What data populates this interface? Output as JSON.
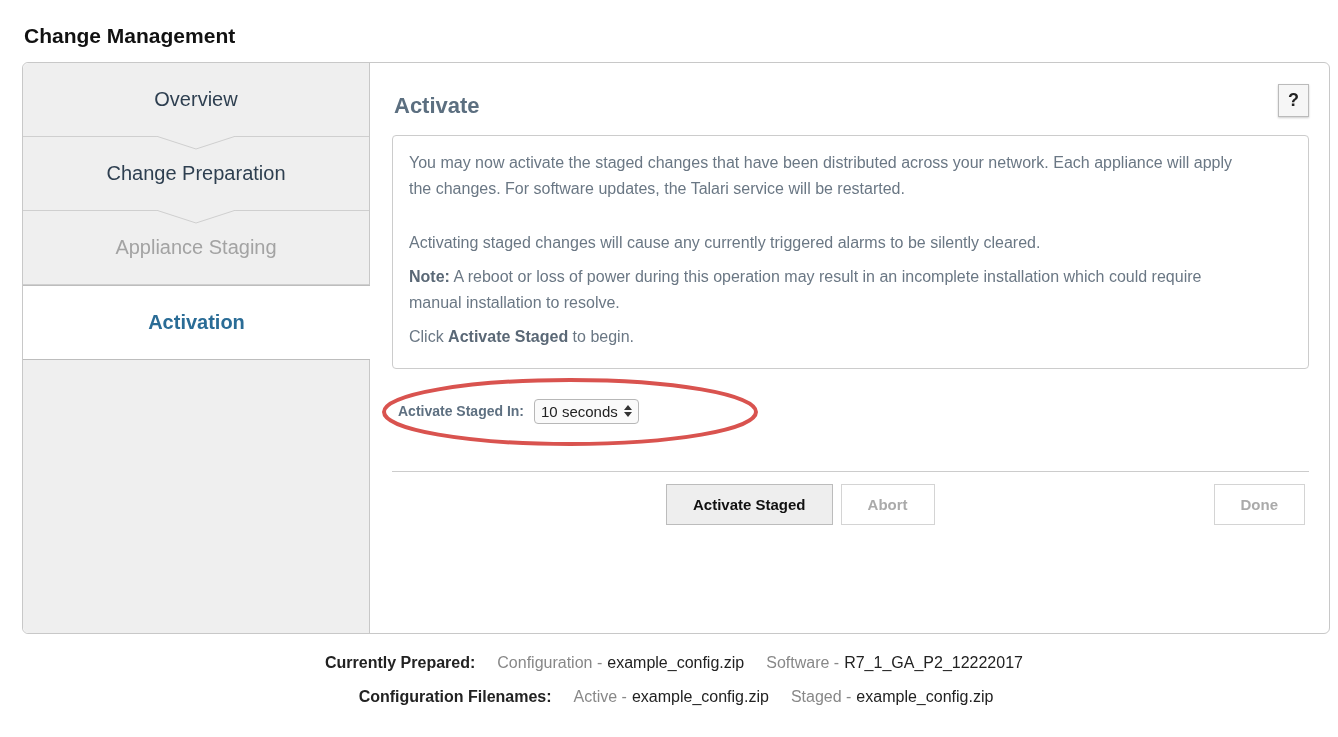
{
  "page_title": "Change Management",
  "steps": [
    {
      "label": "Overview",
      "selected": false,
      "disabled": false
    },
    {
      "label": "Change Preparation",
      "selected": false,
      "disabled": false
    },
    {
      "label": "Appliance Staging",
      "selected": false,
      "disabled": true
    },
    {
      "label": "Activation",
      "selected": true,
      "disabled": false
    }
  ],
  "panel": {
    "title": "Activate",
    "help": "?",
    "message": [
      "You may now activate the staged changes that have been distributed across your network. Each appliance will apply the changes. For software updates, the Talari service will be restarted.",
      "Activating staged changes will cause any currently triggered alarms to be silently cleared.",
      "**Note:** A reboot or loss of power during this operation may result in an incomplete installation which could require manual installation to resolve.",
      "Click **Activate Staged** to begin."
    ],
    "delay": {
      "label": "Activate Staged In:",
      "value": "10 seconds",
      "highlighted": true
    },
    "buttons": [
      {
        "label": "Activate Staged",
        "disabled": false
      },
      {
        "label": "Abort",
        "disabled": true
      },
      {
        "label": "Done",
        "disabled": true
      }
    ]
  },
  "info": [
    {
      "label": "Currently Prepared:",
      "items": [
        {
          "prefix": "Configuration -",
          "value": "example_config.zip"
        },
        {
          "prefix": "Software -",
          "value": "R7_1_GA_P2_12222017"
        }
      ]
    },
    {
      "label": "Configuration Filenames:",
      "items": [
        {
          "prefix": "Active -",
          "value": "example_config.zip"
        },
        {
          "prefix": "Staged -",
          "value": "example_config.zip"
        }
      ]
    }
  ]
}
